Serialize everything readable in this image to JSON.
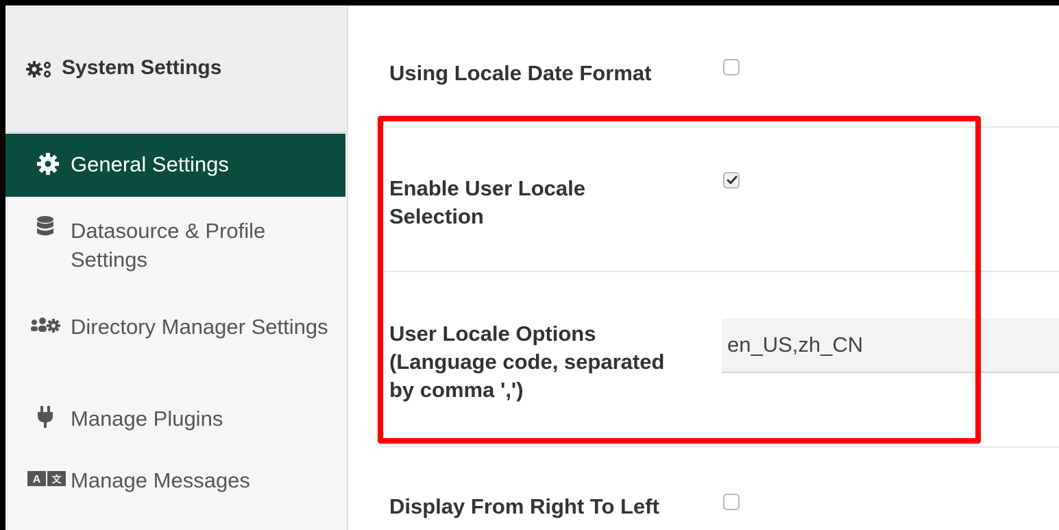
{
  "sidebar": {
    "header": {
      "title": "System Settings",
      "icon": "cogs-icon"
    },
    "items": [
      {
        "label": "General Settings",
        "icon": "gear-icon",
        "active": true
      },
      {
        "label": "Datasource & Profile Settings",
        "icon": "database-icon",
        "active": false
      },
      {
        "label": "Directory Manager Settings",
        "icon": "users-cog-icon",
        "active": false
      },
      {
        "label": "Manage Plugins",
        "icon": "plug-icon",
        "active": false
      },
      {
        "label": "Manage Messages",
        "icon": "language-icon",
        "active": false
      }
    ]
  },
  "main": {
    "fields": [
      {
        "label": "Using Locale Date Format",
        "type": "checkbox",
        "checked": false
      },
      {
        "label": "Enable User Locale Selection",
        "type": "checkbox",
        "checked": true
      },
      {
        "label": "User Locale Options (Language code, separated by comma ',')",
        "type": "text",
        "value": "en_US,zh_CN"
      },
      {
        "label": "Display From Right To Left",
        "type": "checkbox",
        "checked": false
      }
    ]
  },
  "colors": {
    "active_nav_bg": "#0a4c3e",
    "highlight_border": "#ff0000",
    "sidebar_bg": "#f5f6f6",
    "sidebar_header_bg": "#eceeef"
  }
}
